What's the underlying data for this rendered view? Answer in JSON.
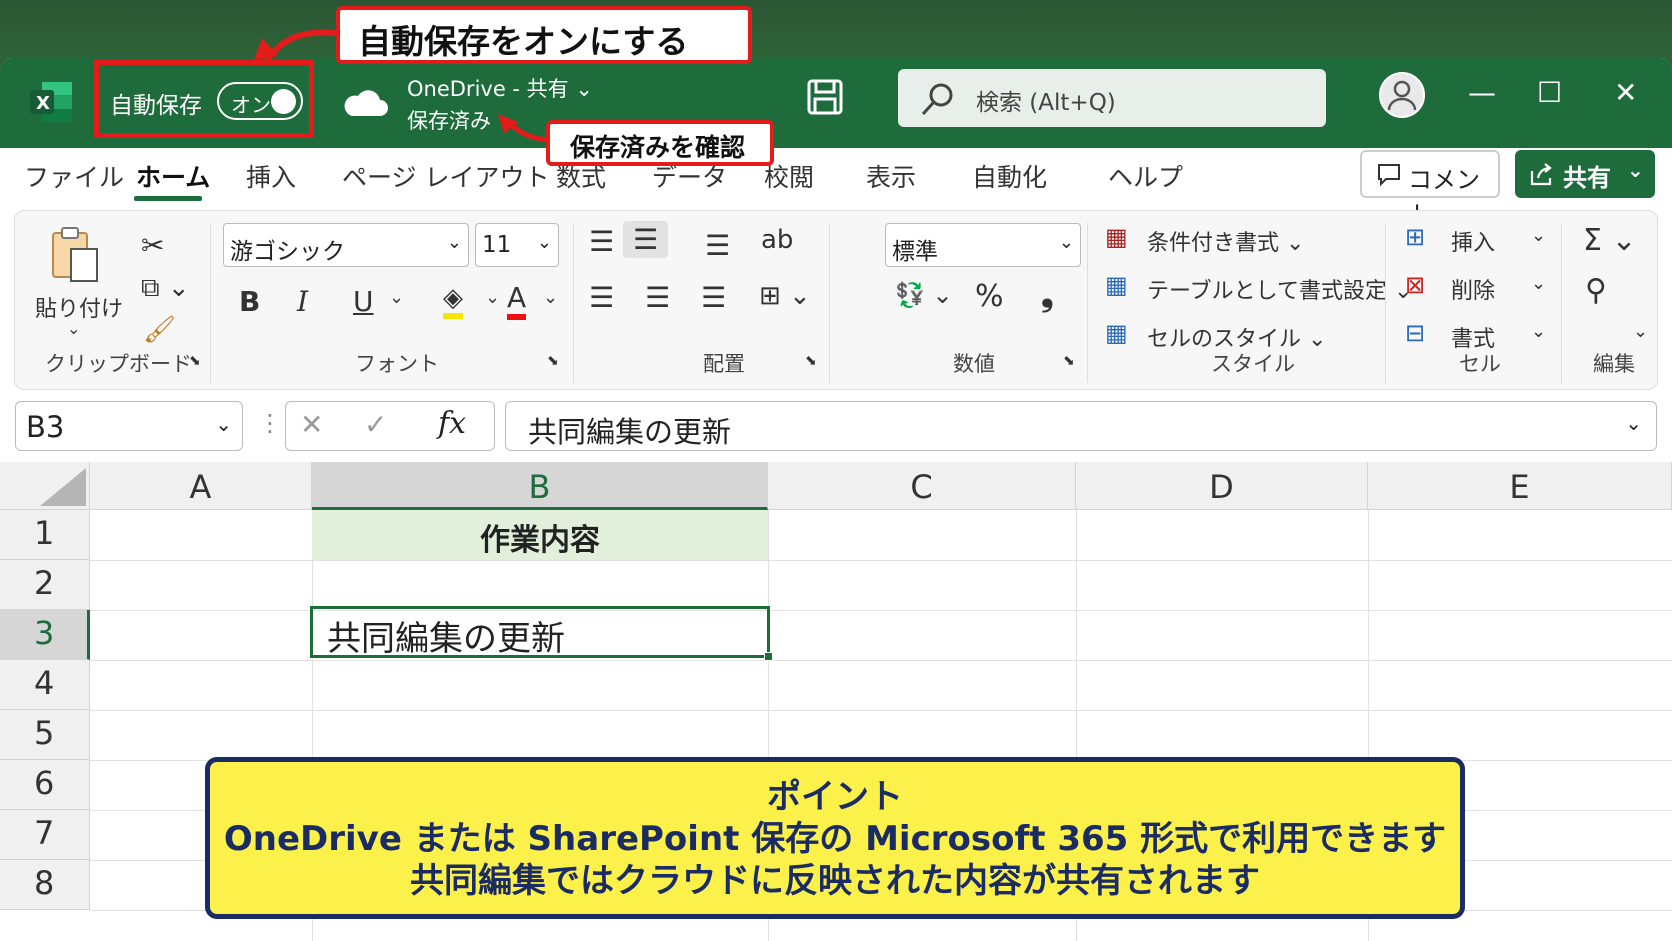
{
  "titlebar": {
    "autosave_label": "自動保存",
    "toggle_state": "オン",
    "location": "OneDrive - 共有 ⌄",
    "save_status": "保存済み",
    "search_placeholder": "検索 (Alt+Q)",
    "minimize": "—",
    "maximize": "☐",
    "close": "✕"
  },
  "callouts": {
    "autosave_on": "自動保存をオンにする",
    "check_saved": "保存済みを確認"
  },
  "menu": {
    "tabs": [
      "ファイル",
      "ホーム",
      "挿入",
      "ページ レイアウト",
      "数式",
      "データ",
      "校閲",
      "表示",
      "自動化",
      "ヘルプ"
    ],
    "active_tab": "ホーム",
    "comment_button": "コメント",
    "share_button": "共有"
  },
  "ribbon": {
    "clipboard": {
      "paste": "貼り付け",
      "label": "クリップボード"
    },
    "font": {
      "name": "游ゴシック",
      "size": "11",
      "label": "フォント"
    },
    "alignment": {
      "label": "配置"
    },
    "number": {
      "format": "標準",
      "label": "数値"
    },
    "styles": {
      "conditional": "条件付き書式 ⌄",
      "table": "テーブルとして書式設定 ⌄",
      "cell_styles": "セルのスタイル ⌄",
      "label": "スタイル"
    },
    "cells": {
      "insert": "挿入",
      "delete": "削除",
      "format": "書式",
      "label": "セル"
    },
    "editing": {
      "label": "編集"
    }
  },
  "formula_bar": {
    "cell_ref": "B3",
    "content": "共同編集の更新"
  },
  "grid": {
    "columns": [
      "A",
      "B",
      "C",
      "D",
      "E"
    ],
    "rows": [
      "1",
      "2",
      "3",
      "4",
      "5",
      "6",
      "7",
      "8"
    ],
    "cells": {
      "B1": "作業内容",
      "B3": "共同編集の更新"
    }
  },
  "point": {
    "title": "ポイント",
    "line1": "OneDrive または SharePoint 保存の Microsoft 365 形式で利用できます",
    "line2": "共同編集ではクラウドに反映された内容が共有されます"
  },
  "colors": {
    "excel_green": "#1e6b3b",
    "callout_red": "#e31b1b",
    "point_yellow": "#fcf04b",
    "point_navy": "#1a2c63"
  }
}
